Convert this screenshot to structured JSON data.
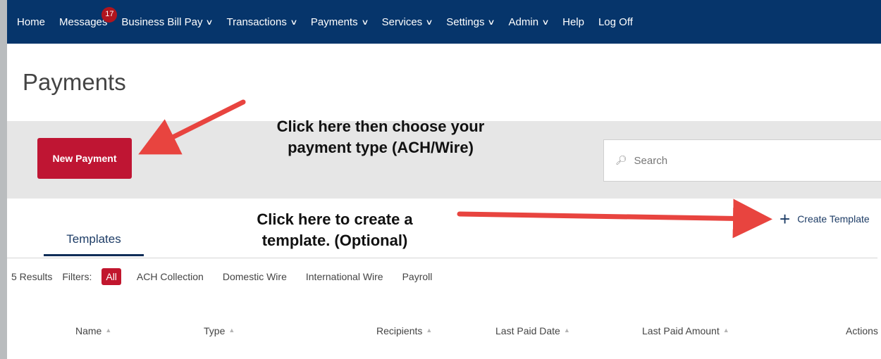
{
  "nav": {
    "home": "Home",
    "messages": "Messages",
    "messages_badge": "17",
    "business_bill_pay": "Business Bill Pay",
    "transactions": "Transactions",
    "payments": "Payments",
    "services": "Services",
    "settings": "Settings",
    "admin": "Admin",
    "help": "Help",
    "log_off": "Log Off",
    "dropdown_icon": "chevron-down-icon"
  },
  "page": {
    "title": "Payments"
  },
  "actions": {
    "new_payment_label": "New Payment",
    "search_placeholder": "Search"
  },
  "annotations": {
    "new_payment_line1": "Click here then choose your",
    "new_payment_line2": "payment type (ACH/Wire)",
    "template_line1": "Click here to create a",
    "template_line2": "template. (Optional)"
  },
  "tabs": {
    "templates": "Templates"
  },
  "create_template_label": "Create Template",
  "filters": {
    "results": "5 Results",
    "label": "Filters:",
    "all": "All",
    "options": [
      "ACH Collection",
      "Domestic Wire",
      "International Wire",
      "Payroll"
    ]
  },
  "table": {
    "columns": [
      "Name",
      "Type",
      "Recipients",
      "Last Paid Date",
      "Last Paid Amount",
      "Actions"
    ]
  },
  "colors": {
    "nav_bg": "#06356b",
    "primary_red": "#bf1533",
    "annotation_arrow": "#e8443f"
  }
}
